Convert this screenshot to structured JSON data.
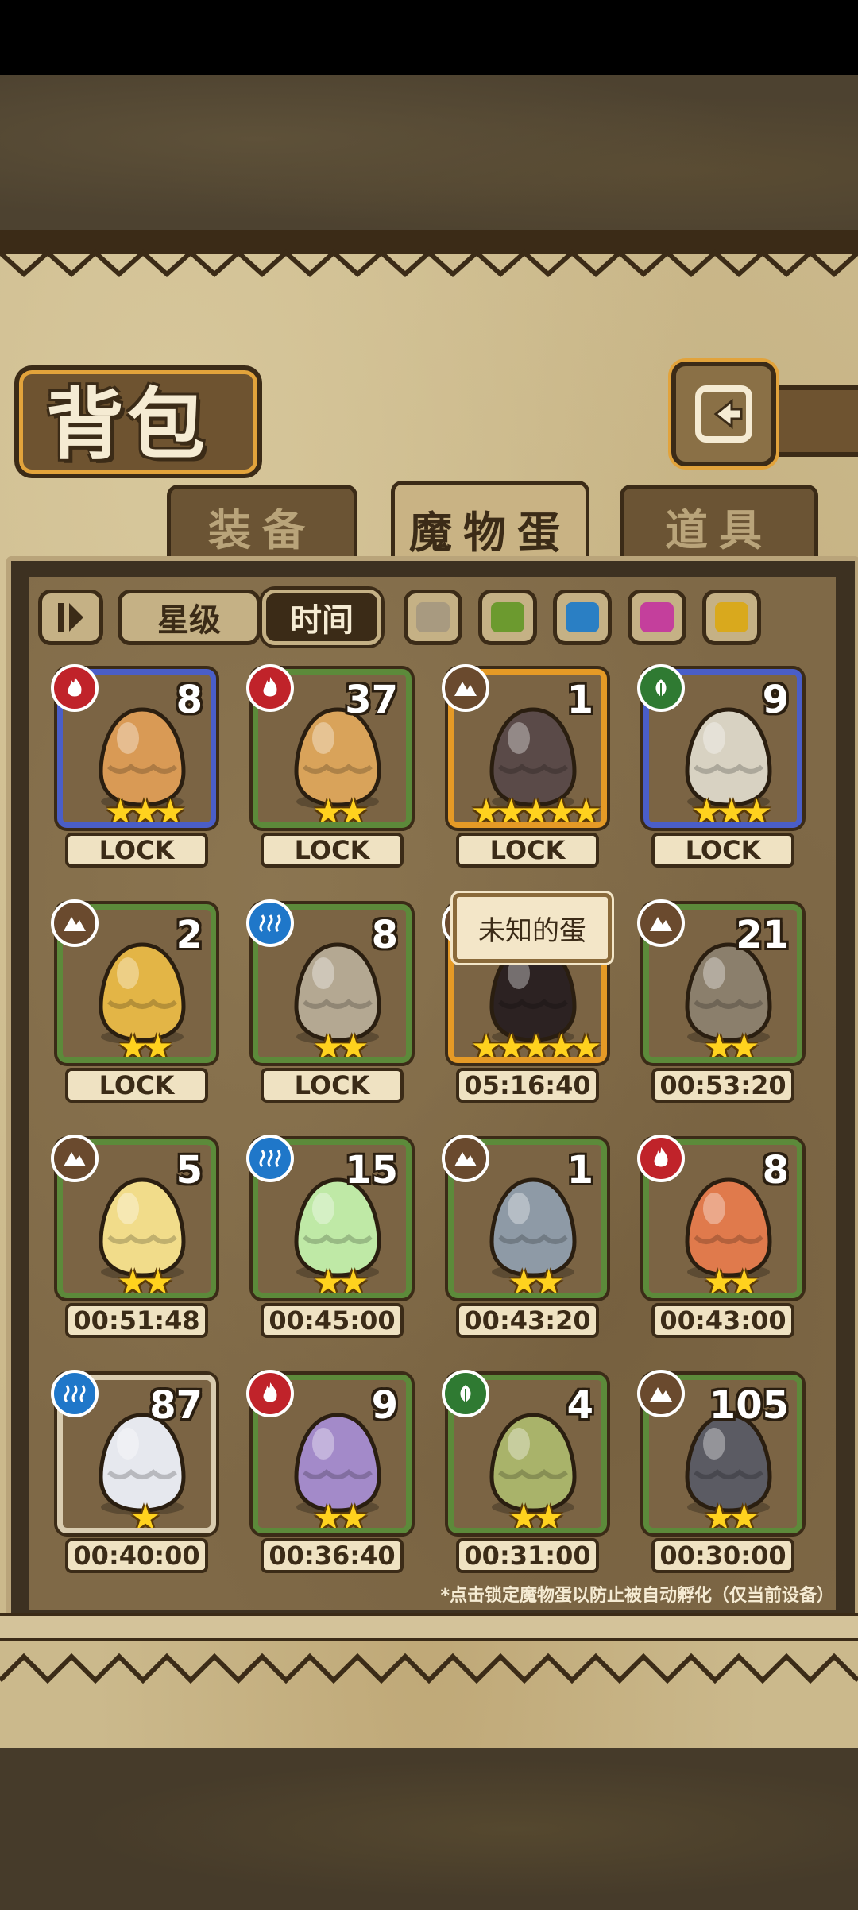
{
  "title": "背包",
  "tabs": [
    {
      "label": "装备",
      "active": false
    },
    {
      "label": "魔物蛋",
      "active": true
    },
    {
      "label": "道具",
      "active": false
    }
  ],
  "filters": {
    "sort_label": "星级",
    "time_label": "时间",
    "swatch_colors": [
      "#a89a80",
      "#6c9a2f",
      "#2a7fc4",
      "#c43f9c",
      "#d9a91d"
    ]
  },
  "tooltip": "未知的蛋",
  "footnote": "*点击锁定魔物蛋以防止被自动孵化（仅当前设备）",
  "eggs": [
    {
      "element": "fire",
      "count": "8",
      "stars": "★★★",
      "rarity": "blue",
      "status": "LOCK",
      "color": "#d99a55"
    },
    {
      "element": "fire",
      "count": "37",
      "stars": "★★",
      "rarity": "green",
      "status": "LOCK",
      "color": "#d9a35a"
    },
    {
      "element": "earth",
      "count": "1",
      "stars": "★★★★★",
      "rarity": "orange",
      "status": "LOCK",
      "color": "#5a4a48"
    },
    {
      "element": "grass",
      "count": "9",
      "stars": "★★★",
      "rarity": "blue",
      "status": "LOCK",
      "color": "#d8d2c2"
    },
    {
      "element": "earth",
      "count": "2",
      "stars": "★★",
      "rarity": "green",
      "status": "LOCK",
      "color": "#e3b546"
    },
    {
      "element": "water",
      "count": "8",
      "stars": "★★",
      "rarity": "green",
      "status": "LOCK",
      "color": "#b4a892"
    },
    {
      "element": "earth",
      "count": "",
      "stars": "★★★★★",
      "rarity": "orange",
      "status": "05:16:40",
      "color": "#2c2222"
    },
    {
      "element": "earth",
      "count": "21",
      "stars": "★★",
      "rarity": "green",
      "status": "00:53:20",
      "color": "#8b7f6c"
    },
    {
      "element": "earth",
      "count": "5",
      "stars": "★★",
      "rarity": "green",
      "status": "00:51:48",
      "color": "#f1dc8a"
    },
    {
      "element": "water",
      "count": "15",
      "stars": "★★",
      "rarity": "green",
      "status": "00:45:00",
      "color": "#bfe9a6"
    },
    {
      "element": "earth",
      "count": "1",
      "stars": "★★",
      "rarity": "green",
      "status": "00:43:20",
      "color": "#8e9aa6"
    },
    {
      "element": "fire",
      "count": "8",
      "stars": "★★",
      "rarity": "green",
      "status": "00:43:00",
      "color": "#e07a4c"
    },
    {
      "element": "water",
      "count": "87",
      "stars": "★",
      "rarity": "white",
      "status": "00:40:00",
      "color": "#e6e8ee"
    },
    {
      "element": "fire",
      "count": "9",
      "stars": "★★",
      "rarity": "green",
      "status": "00:36:40",
      "color": "#a38ac9"
    },
    {
      "element": "grass",
      "count": "4",
      "stars": "★★",
      "rarity": "green",
      "status": "00:31:00",
      "color": "#a9b36a"
    },
    {
      "element": "earth",
      "count": "105",
      "stars": "★★",
      "rarity": "green",
      "status": "00:30:00",
      "color": "#5b5b63"
    }
  ]
}
